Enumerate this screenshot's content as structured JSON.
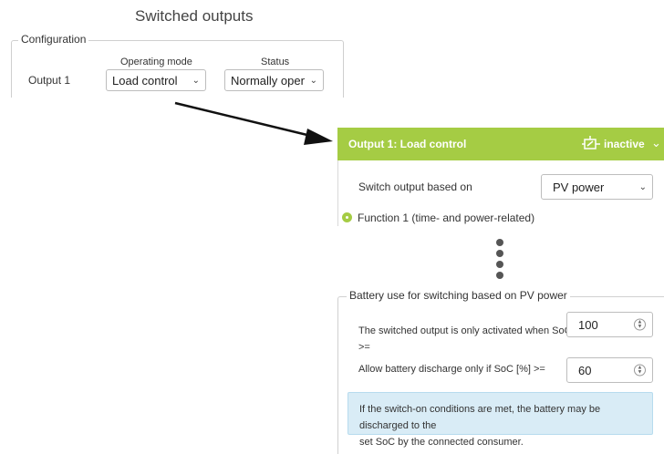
{
  "page_title": "Switched outputs",
  "configuration": {
    "legend": "Configuration",
    "col_operating_mode": "Operating mode",
    "col_status": "Status",
    "output_label": "Output 1",
    "operating_mode_value": "Load control",
    "status_value": "Normally open cor"
  },
  "output_panel": {
    "header_title": "Output 1: Load control",
    "header_status": "inactive",
    "switch_based_on_label": "Switch output based on",
    "switch_based_on_value": "PV power",
    "function_label": "Function 1 (time- and power-related)"
  },
  "battery": {
    "legend": "Battery use for switching based on PV power",
    "soc_activate_label_line1": "The switched output is only activated when SoC [%]",
    "soc_activate_label_line2": ">=",
    "soc_activate_value": "100",
    "discharge_label": "Allow battery discharge only if SoC [%] >=",
    "discharge_value": "60",
    "info_line1": "If the switch-on conditions are met, the battery may be discharged to the",
    "info_line2": "set SoC by the connected consumer."
  },
  "colors": {
    "accent_green": "#a5cc44",
    "info_background": "#d9ecf6"
  },
  "icons": {
    "relay": "relay-switch-icon",
    "chevron": "chevron-down-icon"
  }
}
